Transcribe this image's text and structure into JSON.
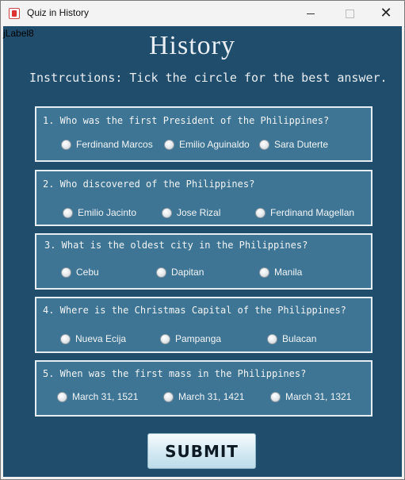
{
  "window": {
    "title": "Quiz in History"
  },
  "debug_label": "jLabel8",
  "heading": "History",
  "instructions": "Instrcutions: Tick the circle for the best answer.",
  "questions": [
    {
      "text": "1. Who was the first President of the Philippines?",
      "options": [
        "Ferdinand Marcos",
        "Emilio Aguinaldo",
        "Sara Duterte"
      ]
    },
    {
      "text": "2. Who discovered of the Philippines?",
      "options": [
        "Emilio Jacinto",
        "Jose Rizal",
        "Ferdinand Magellan"
      ]
    },
    {
      "text": "3. What is the oldest city in the Philippines?",
      "options": [
        "Cebu",
        "Dapitan",
        "Manila"
      ]
    },
    {
      "text": "4. Where is the Christmas Capital of the Philippines?",
      "options": [
        "Nueva Ecija",
        "Pampanga",
        "Bulacan"
      ]
    },
    {
      "text": "5. When was the first mass in the Philippines?",
      "options": [
        "March 31, 1521",
        "March 31, 1421",
        "March 31, 1321"
      ]
    }
  ],
  "submit_label": "SUBMIT",
  "colors": {
    "background": "#1f4d6b",
    "question_box": "#3f7594",
    "border": "#e6eef4"
  }
}
